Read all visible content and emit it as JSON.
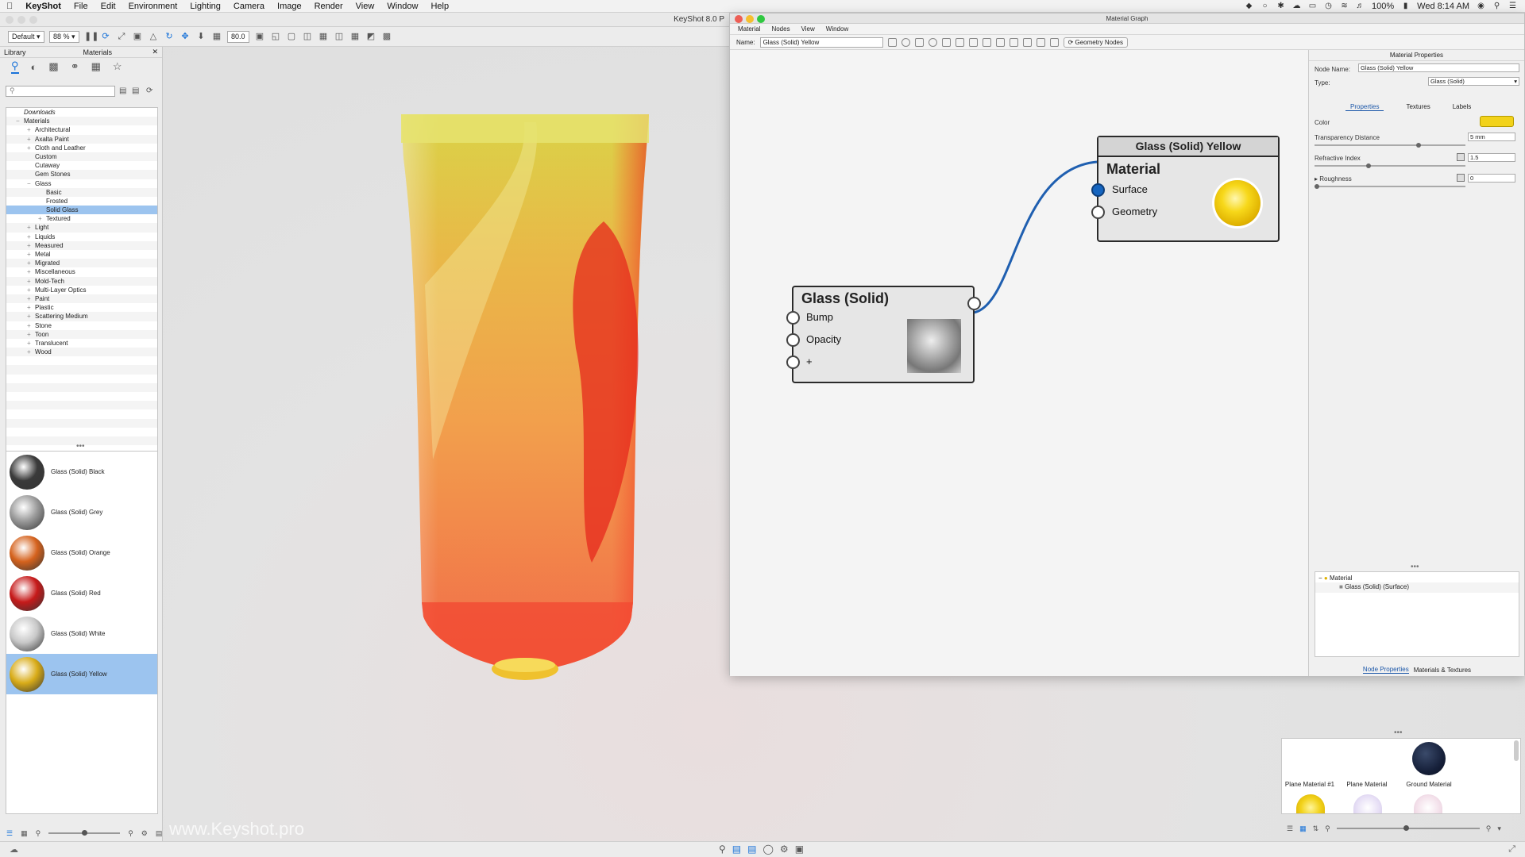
{
  "menubar": {
    "app": "KeyShot",
    "items": [
      "File",
      "Edit",
      "Environment",
      "Lighting",
      "Camera",
      "Image",
      "Render",
      "View",
      "Window",
      "Help"
    ],
    "battery": "100%",
    "clock": "Wed 8:14 AM"
  },
  "window": {
    "title": "KeyShot 8.0 P"
  },
  "toolbar": {
    "preset": "Default",
    "zoom": "88 %",
    "value": "80.0"
  },
  "library": {
    "title": "Library",
    "tab": "Materials",
    "tree": [
      {
        "label": "Downloads",
        "level": 0,
        "italic": true,
        "sign": ""
      },
      {
        "label": "Materials",
        "level": 0,
        "italic": false,
        "sign": "−"
      },
      {
        "label": "Architectural",
        "level": 1,
        "sign": "+"
      },
      {
        "label": "Axalta Paint",
        "level": 1,
        "sign": "+"
      },
      {
        "label": "Cloth and Leather",
        "level": 1,
        "sign": "+"
      },
      {
        "label": "Custom",
        "level": 1,
        "sign": ""
      },
      {
        "label": "Cutaway",
        "level": 1,
        "sign": ""
      },
      {
        "label": "Gem Stones",
        "level": 1,
        "sign": ""
      },
      {
        "label": "Glass",
        "level": 1,
        "sign": "−"
      },
      {
        "label": "Basic",
        "level": 2,
        "sign": ""
      },
      {
        "label": "Frosted",
        "level": 2,
        "sign": ""
      },
      {
        "label": "Solid Glass",
        "level": 2,
        "sign": "",
        "selected": true
      },
      {
        "label": "Textured",
        "level": 2,
        "sign": "+"
      },
      {
        "label": "Light",
        "level": 1,
        "sign": "+"
      },
      {
        "label": "Liquids",
        "level": 1,
        "sign": "+"
      },
      {
        "label": "Measured",
        "level": 1,
        "sign": "+"
      },
      {
        "label": "Metal",
        "level": 1,
        "sign": "+"
      },
      {
        "label": "Migrated",
        "level": 1,
        "sign": "+"
      },
      {
        "label": "Miscellaneous",
        "level": 1,
        "sign": "+"
      },
      {
        "label": "Mold-Tech",
        "level": 1,
        "sign": "+"
      },
      {
        "label": "Multi-Layer Optics",
        "level": 1,
        "sign": "+"
      },
      {
        "label": "Paint",
        "level": 1,
        "sign": "+"
      },
      {
        "label": "Plastic",
        "level": 1,
        "sign": "+"
      },
      {
        "label": "Scattering Medium",
        "level": 1,
        "sign": "+"
      },
      {
        "label": "Stone",
        "level": 1,
        "sign": "+"
      },
      {
        "label": "Toon",
        "level": 1,
        "sign": "+"
      },
      {
        "label": "Translucent",
        "level": 1,
        "sign": "+"
      },
      {
        "label": "Wood",
        "level": 1,
        "sign": "+"
      }
    ],
    "thumbnails": [
      {
        "label": "Glass (Solid) Black",
        "color": "#3a3a3a"
      },
      {
        "label": "Glass (Solid) Grey",
        "color": "#9a9a9a"
      },
      {
        "label": "Glass (Solid) Orange",
        "color": "#d5621d"
      },
      {
        "label": "Glass (Solid) Red",
        "color": "#c61a1a"
      },
      {
        "label": "Glass (Solid) White",
        "color": "#c8c8c8"
      },
      {
        "label": "Glass (Solid) Yellow",
        "color": "#d9ac18",
        "selected": true
      }
    ]
  },
  "viewport": {
    "watermark": "www.Keyshot.pro"
  },
  "material_graph": {
    "title": "Material Graph",
    "menu": [
      "Material",
      "Nodes",
      "View",
      "Window"
    ],
    "name_label": "Name:",
    "name_value": "Glass (Solid) Yellow",
    "geometry_button": "Geometry Nodes",
    "node_material": {
      "header": "Glass (Solid) Yellow",
      "title": "Material",
      "ports": [
        "Surface",
        "Geometry"
      ]
    },
    "node_glass": {
      "title": "Glass (Solid)",
      "ports": [
        "Bump",
        "Opacity",
        "+"
      ]
    }
  },
  "properties": {
    "title": "Material Properties",
    "node_name_label": "Node Name:",
    "node_name": "Glass (Solid) Yellow",
    "type_label": "Type:",
    "type_value": "Glass (Solid)",
    "tabs": [
      "Properties",
      "Textures",
      "Labels"
    ],
    "color_label": "Color",
    "color": "#f2d21a",
    "transparency_label": "Transparency Distance",
    "transparency_value": "5 mm",
    "refractive_label": "Refractive Index",
    "refractive_value": "1.5",
    "roughness_label": "Roughness",
    "roughness_value": "0",
    "tree": [
      "Material",
      "Glass (Solid) (Surface)"
    ],
    "footer_tabs": [
      "Node Properties",
      "Materials & Textures"
    ]
  },
  "project_materials": [
    {
      "label": "Plane Material #1"
    },
    {
      "label": "Plane Material"
    },
    {
      "label": "Ground Material"
    }
  ]
}
